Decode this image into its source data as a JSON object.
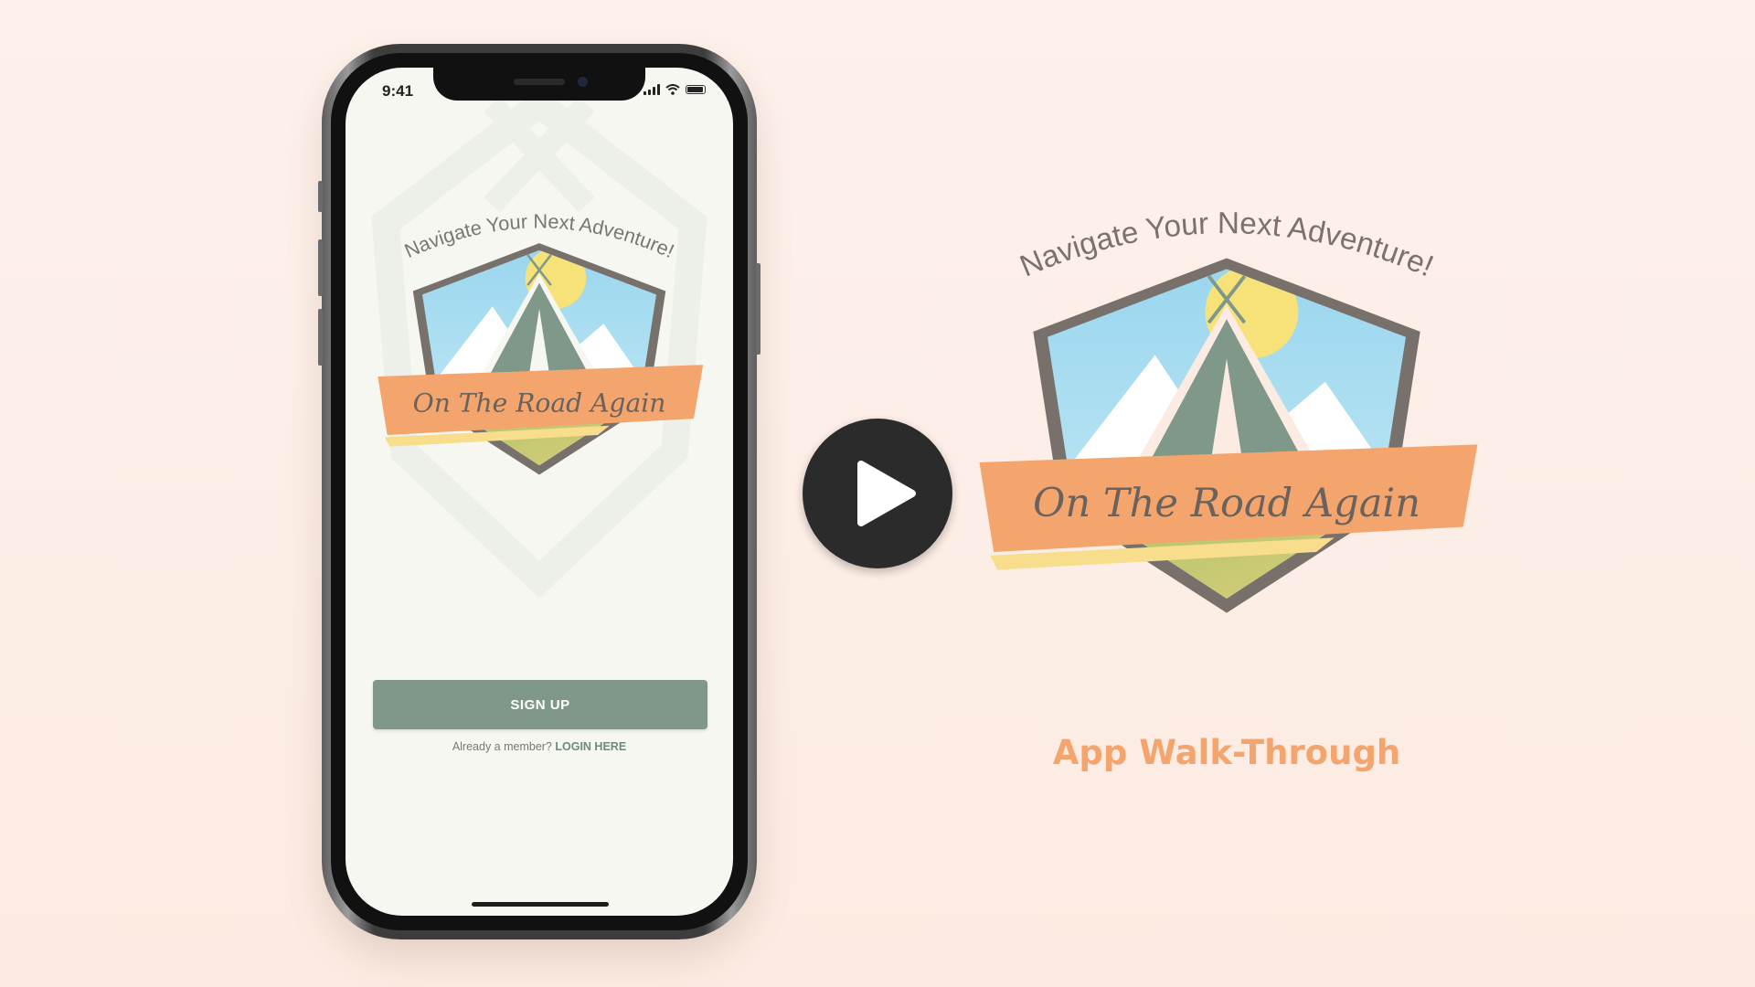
{
  "status_bar": {
    "time": "9:41"
  },
  "logo": {
    "tagline": "Navigate Your Next Adventure!",
    "brand": "On The Road Again"
  },
  "app": {
    "signup_label": "SIGN UP",
    "login_prompt": "Already a member?",
    "login_link": "LOGIN HERE"
  },
  "video": {
    "title": "App Walk-Through",
    "play_icon": "play-icon"
  },
  "colors": {
    "accent_orange": "#f4a46d",
    "button_green": "#7f988a",
    "sky_blue": "#8fd0ea",
    "sun_yellow": "#f7e27a",
    "hill_green": "#b7c96e",
    "badge_frame": "#78706b",
    "tent_green": "#7f988a",
    "background": "#fdf1ea"
  }
}
